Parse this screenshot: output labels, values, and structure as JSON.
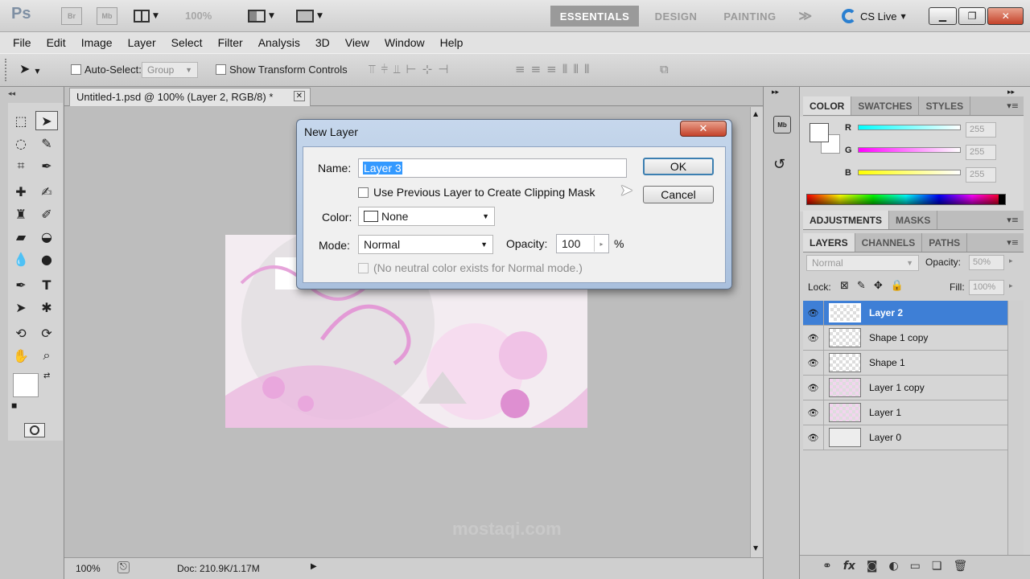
{
  "appbar": {
    "logo": "Ps",
    "bridge": "Br",
    "minibridge": "Mb",
    "zoom": "100%",
    "workspaces": [
      "ESSENTIALS",
      "DESIGN",
      "PAINTING"
    ],
    "more": "≫",
    "cslive": "CS Live",
    "window_controls": {
      "min": "▁",
      "restore": "❐",
      "close": "✕"
    }
  },
  "menu": [
    "File",
    "Edit",
    "Image",
    "Layer",
    "Select",
    "Filter",
    "Analysis",
    "3D",
    "View",
    "Window",
    "Help"
  ],
  "options": {
    "auto_select_label": "Auto-Select:",
    "auto_select_value": "Group",
    "transform_label": "Show Transform Controls"
  },
  "document": {
    "tab_title": "Untitled-1.psd @ 100% (Layer 2, RGB/8) *",
    "tab_close": "✕",
    "status_zoom": "100%",
    "status_doc": "Doc: 210.9K/1.17M",
    "watermark": "mostaqi.com"
  },
  "panels": {
    "color_tabs": [
      "COLOR",
      "SWATCHES",
      "STYLES"
    ],
    "channels": [
      {
        "label": "R",
        "value": "255",
        "gradient": "linear-gradient(90deg,#00ffff,#ffffff)"
      },
      {
        "label": "G",
        "value": "255",
        "gradient": "linear-gradient(90deg,#ff00ff,#ffffff)"
      },
      {
        "label": "B",
        "value": "255",
        "gradient": "linear-gradient(90deg,#ffff00,#ffffff)"
      }
    ],
    "adj_tabs": [
      "ADJUSTMENTS",
      "MASKS"
    ],
    "layer_tabs": [
      "LAYERS",
      "CHANNELS",
      "PATHS"
    ],
    "blend_mode": "Normal",
    "opacity_label": "Opacity:",
    "opacity_value": "50%",
    "lock_label": "Lock:",
    "fill_label": "Fill:",
    "fill_value": "100%",
    "layers": [
      {
        "name": "Layer 2",
        "selected": true,
        "thumb": "checker"
      },
      {
        "name": "Shape 1 copy",
        "selected": false,
        "thumb": "checker"
      },
      {
        "name": "Shape 1",
        "selected": false,
        "thumb": "checker"
      },
      {
        "name": "Layer 1 copy",
        "selected": false,
        "thumb": "pink"
      },
      {
        "name": "Layer 1",
        "selected": false,
        "thumb": "pink"
      },
      {
        "name": "Layer 0",
        "selected": false,
        "thumb": "plain"
      }
    ],
    "bottom_icons": [
      "link-icon",
      "fx-icon",
      "mask-icon",
      "adjustment-icon",
      "folder-icon",
      "new-layer-icon",
      "trash-icon"
    ]
  },
  "dialog": {
    "title": "New Layer",
    "close": "✕",
    "name_label": "Name:",
    "name_value": "Layer 3",
    "clip_label": "Use Previous Layer to Create Clipping Mask",
    "color_label": "Color:",
    "color_value": "None",
    "mode_label": "Mode:",
    "mode_value": "Normal",
    "opacity_label": "Opacity:",
    "opacity_value": "100",
    "percent": "%",
    "neutral_label": "(No neutral color exists for Normal mode.)",
    "ok": "OK",
    "cancel": "Cancel"
  },
  "colors": {
    "accent_selected": "#3e7fd6",
    "artboard_pink": "#e9a7dd"
  }
}
